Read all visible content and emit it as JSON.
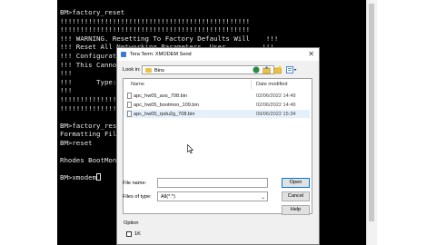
{
  "terminal": {
    "lines": [
      "BM>factory_reset",
      "!!!!!!!!!!!!!!!!!!!!!!!!!!!!!!!!!!!!!!!!!!!!!!!",
      "!!!!!!!!!!!!!!!!!!!!!!!!!!!!!!!!!!!!!!!!!!!!!!!",
      "!!! WARNING. Resetting To Factory Defaults Will    !!!",
      "!!! Reset All Networking Parameters, User         !!!",
      "!!! Configurati",
      "!!! This Cannot",
      "!!!",
      "!!!      Type:",
      "!!!",
      "!!!!!!!!!!!!!!!",
      "!!!!!!!!!!!!!!!",
      "",
      "BM>factory_reset",
      "Formatting File",
      "BM>reset",
      "",
      "Rhodes BootMoni",
      "",
      "BM>xmodem"
    ]
  },
  "dialog": {
    "title": "Tera Term: XMODEM Send",
    "close": "✕",
    "look_in_label": "Look in:",
    "look_in_value": "Bins",
    "columns": {
      "name": "Name",
      "date": "Date modified"
    },
    "files": [
      {
        "name": "apc_hw05_aos_708.bin",
        "date": "02/06/2022 14:49"
      },
      {
        "name": "apc_hw05_bootmon_109.bin",
        "date": "02/06/2022 14:49"
      },
      {
        "name": "apc_hw05_rpdu2g_708.bin",
        "date": "09/06/2022 15:34"
      }
    ],
    "file_name_label": "File name:",
    "file_name_value": "",
    "files_of_type_label": "Files of type:",
    "files_of_type_value": "All(*.*)",
    "open_button": "Open",
    "cancel_button": "Cancel",
    "help_button": "Help",
    "option_label": "Option",
    "checkbox_label": "1K",
    "checkbox_checked": false
  }
}
